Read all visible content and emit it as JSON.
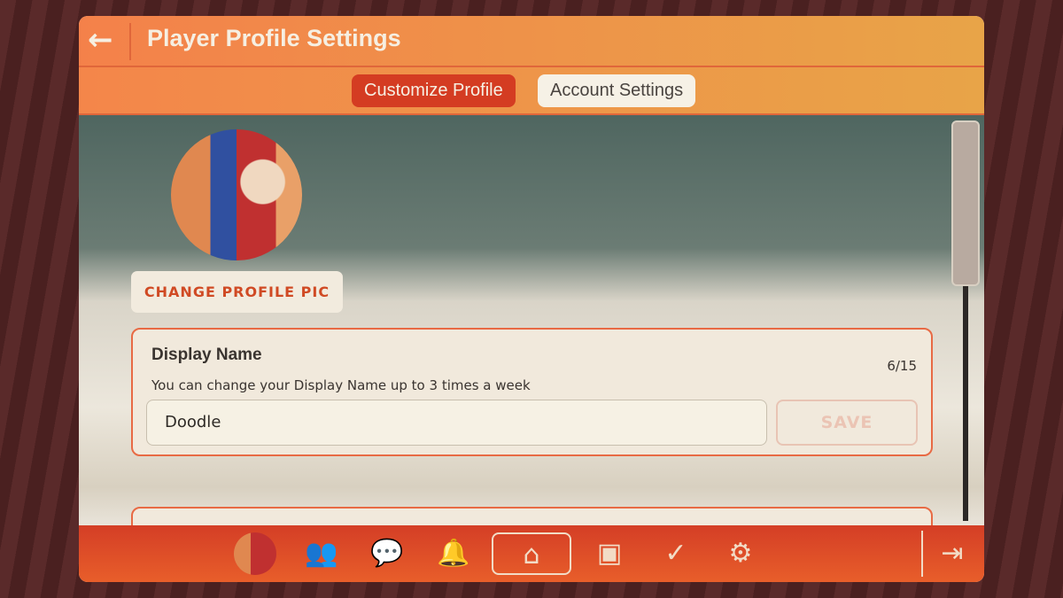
{
  "header": {
    "title": "Player Profile Settings",
    "back_icon": "arrow-left-icon"
  },
  "tabs": [
    {
      "label": "Customize Profile",
      "active": true
    },
    {
      "label": "Account Settings",
      "active": false
    }
  ],
  "profile": {
    "change_pic_label": "CHANGE PROFILE PIC"
  },
  "display_name": {
    "title": "Display Name",
    "hint": "You can change your Display Name up to 3 times a week",
    "count": "6/15",
    "value": "Doodle",
    "save_label": "SAVE"
  },
  "nav": {
    "items": [
      "avatar",
      "friends-icon",
      "chat-icon",
      "bell-icon",
      "home-icon",
      "backpack-icon",
      "shield-check-icon",
      "gear-icon",
      "exit-icon"
    ],
    "active": "home-icon"
  },
  "colors": {
    "accent": "#d43c22",
    "header": "#f4814a"
  }
}
